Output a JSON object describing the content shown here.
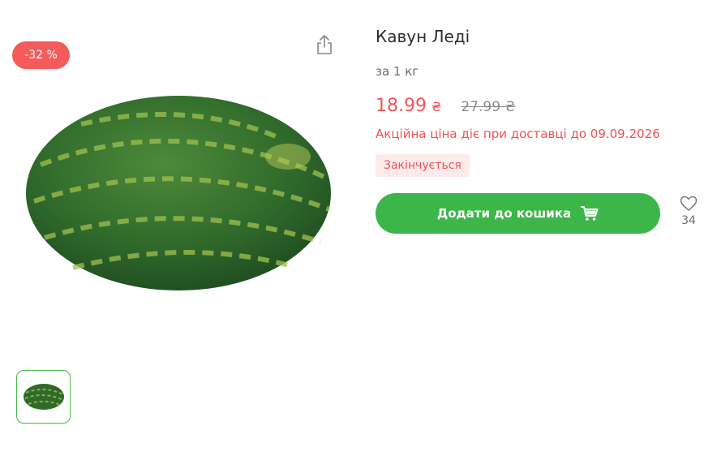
{
  "product": {
    "discount_badge": "-32 %",
    "title": "Кавун Леді",
    "unit": "за 1 кг",
    "price": "18.99",
    "currency": "₴",
    "old_price": "27.99 ₴",
    "promo_text": "Акційна ціна діє при доставці до 09.09.2026",
    "stock_status": "Закінчується",
    "add_to_cart_label": "Додати до кошика",
    "favorites_count": "34"
  },
  "icons": {
    "share": "share-icon",
    "cart": "cart-icon",
    "favorite": "heart-icon"
  },
  "colors": {
    "accent_green": "#3db649",
    "sale_red": "#f0545b",
    "badge_red": "#f45b5b",
    "status_bg": "#fdebeb"
  }
}
